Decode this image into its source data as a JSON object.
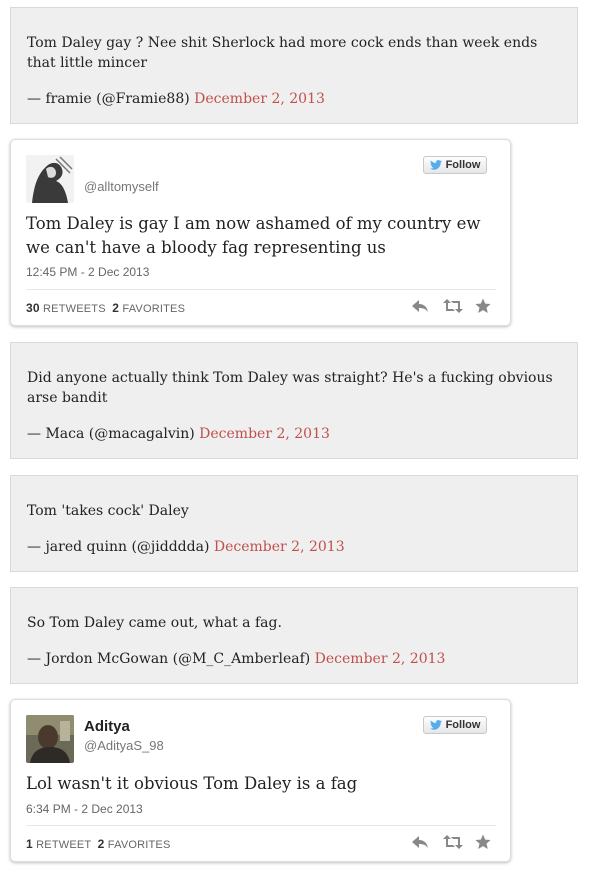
{
  "quotes": [
    {
      "text": "Tom Daley gay ? Nee shit Sherlock had more cock ends than week ends that little mincer",
      "attribution": "— framie (@Framie88)",
      "date": "December 2, 2013"
    },
    {
      "text": "Did anyone actually think Tom Daley was straight? He's a fucking obvious arse bandit",
      "attribution": "— Maca (@macagalvin)",
      "date": "December 2, 2013"
    },
    {
      "text": "Tom 'takes cock' Daley",
      "attribution": "— jared quinn (@jidddda)",
      "date": "December 2, 2013"
    },
    {
      "text": "So Tom Daley came out, what a fag.",
      "attribution": "— Jordon McGowan (@M_C_Amberleaf)",
      "date": "December 2, 2013"
    }
  ],
  "tweets": [
    {
      "name": "",
      "handle": "@alltomyself",
      "follow_label": "Follow",
      "text": "Tom Daley is gay I am now ashamed of my country ew we can't have a bloody fag representing us",
      "time": "12:45 PM - 2 Dec 2013",
      "retweet_count": "30",
      "retweet_label": "RETWEETS",
      "favorite_count": "2",
      "favorite_label": "FAVORITES"
    },
    {
      "name": "Aditya",
      "handle": "@AdityaS_98",
      "follow_label": "Follow",
      "text": "Lol wasn't it obvious Tom Daley is a fag",
      "time": "6:34 PM - 2 Dec 2013",
      "retweet_count": "1",
      "retweet_label": "RETWEET",
      "favorite_count": "2",
      "favorite_label": "FAVORITES"
    }
  ],
  "colors": {
    "date": "#c0504d",
    "twitter_bird": "#55acee",
    "quote_bg": "#efefef"
  },
  "icons": {
    "follow": "twitter-bird-icon",
    "reply": "reply-icon",
    "retweet": "retweet-icon",
    "favorite": "star-icon"
  }
}
